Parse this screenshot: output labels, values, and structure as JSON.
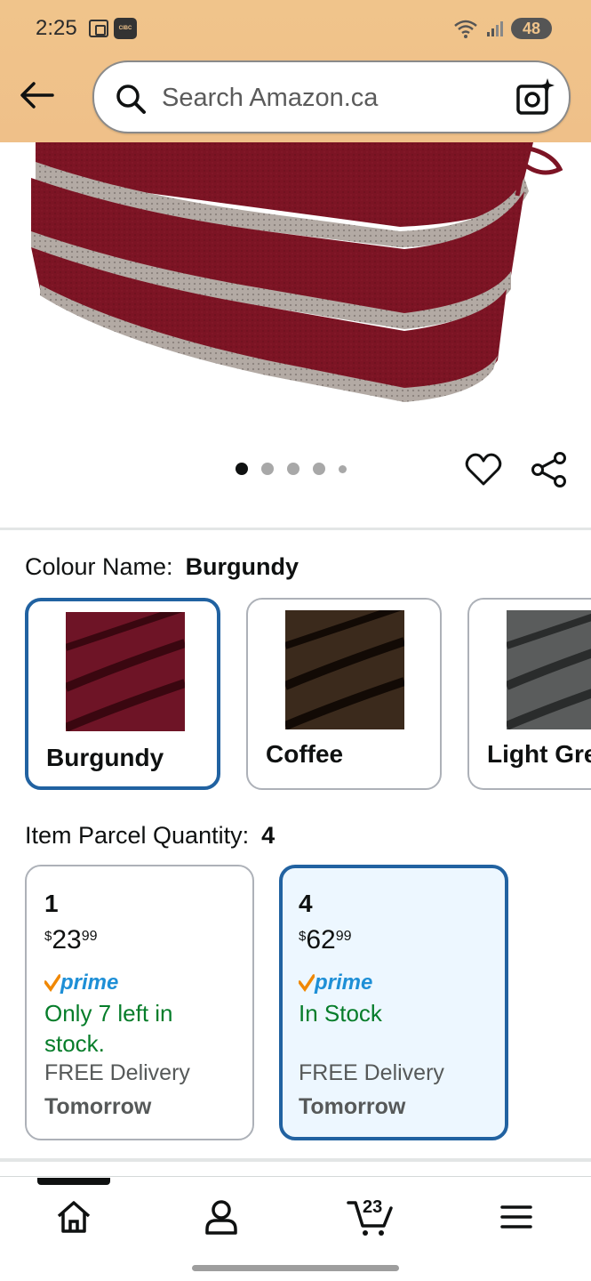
{
  "status_bar": {
    "time": "2:25",
    "notif_icon_label": "CIBC",
    "battery": "48"
  },
  "search": {
    "placeholder": "Search Amazon.ca"
  },
  "carousel": {
    "dot_count": 5,
    "active_index": 0
  },
  "colour": {
    "label": "Colour Name:",
    "selected": "Burgundy",
    "options": [
      {
        "name": "Burgundy",
        "swatch_color": "#6e1426"
      },
      {
        "name": "Coffee",
        "swatch_color": "#3b2a1c"
      },
      {
        "name": "Light Gre",
        "swatch_color": "#5a5c5c"
      }
    ]
  },
  "quantity": {
    "label": "Item Parcel Quantity:",
    "selected": "4",
    "options": [
      {
        "qty": "1",
        "currency": "$",
        "dollars": "23",
        "cents": "99",
        "prime": "prime",
        "stock": "Only 7 left in stock.",
        "delivery": "FREE Delivery",
        "delivery_day": "Tomorrow"
      },
      {
        "qty": "4",
        "currency": "$",
        "dollars": "62",
        "cents": "99",
        "prime": "prime",
        "stock": "In Stock",
        "delivery": "FREE Delivery",
        "delivery_day": "Tomorrow"
      }
    ]
  },
  "nav": {
    "cart_count": "23",
    "items": [
      "home-icon",
      "account-icon",
      "cart-icon",
      "menu-icon"
    ]
  },
  "colors": {
    "header": "#f0c48b",
    "selected_border": "#2162a1",
    "stock_green": "#067d2a",
    "prime_blue": "#1e8fd6",
    "prime_check": "#f08804"
  }
}
